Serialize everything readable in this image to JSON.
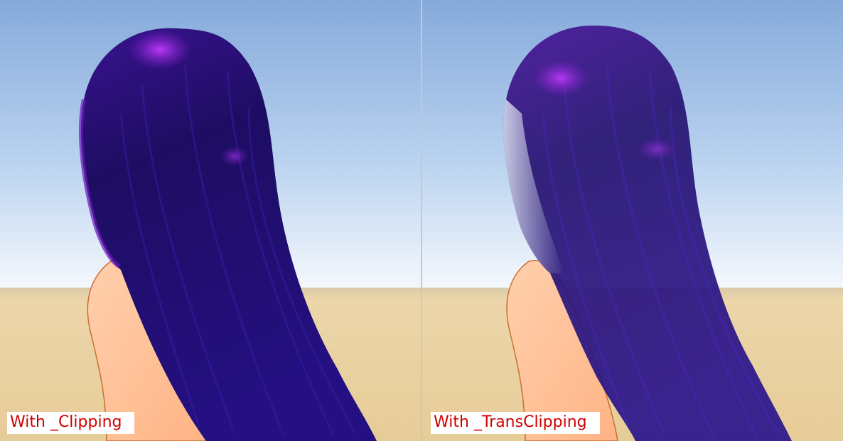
{
  "panels": [
    {
      "caption": "With _Clipping"
    },
    {
      "caption": "With _TransClipping"
    }
  ],
  "colors": {
    "caption_text": "#d00000",
    "caption_background": "#ffffff",
    "sky_top": "#8aaedf",
    "sky_horizon": "#f4f8fc",
    "ground": "#e9d2a4",
    "hair_dark": "#1c0e5c",
    "hair_highlight": "#8a1fd4",
    "skin": "#ffbe94"
  }
}
